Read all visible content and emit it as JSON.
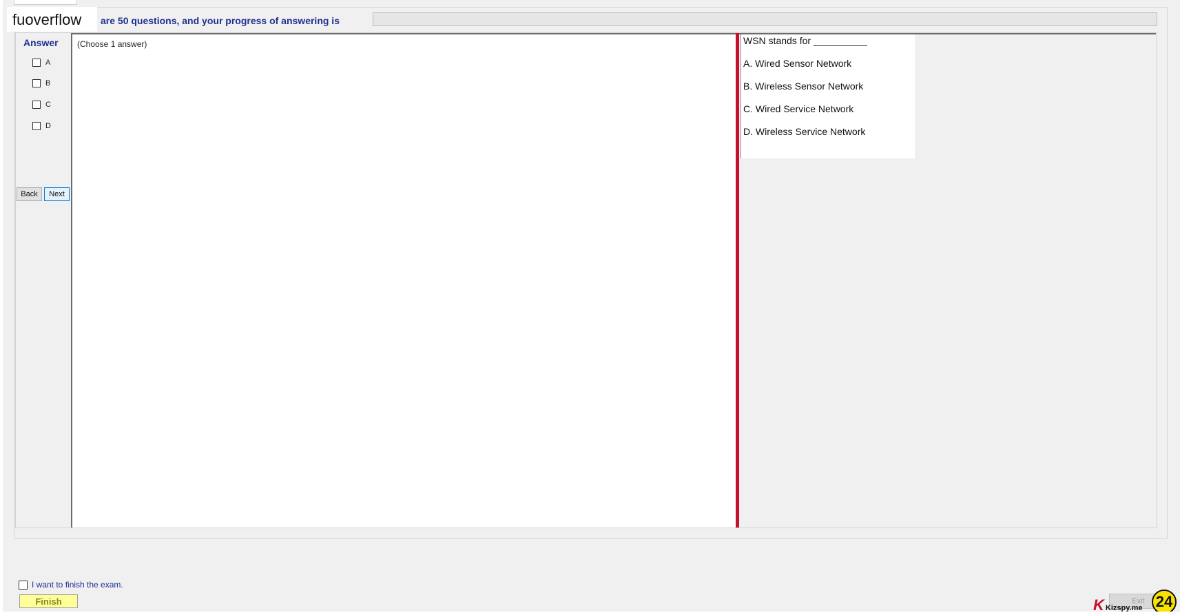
{
  "header": {
    "logo_text": "fuoverflow",
    "progress_text": "are 50 questions, and your progress of answering is",
    "progress_fraction": 0
  },
  "answer_panel": {
    "title": "Answer",
    "options": [
      "A",
      "B",
      "C",
      "D"
    ],
    "back_label": "Back",
    "next_label": "Next"
  },
  "content": {
    "instruction": "(Choose 1 answer)"
  },
  "question": {
    "stem": "WSN stands for __________",
    "choices": [
      "A.  Wired Sensor Network",
      "B.  Wireless Sensor Network",
      "C.  Wired Service Network",
      "D.  Wireless Service Network"
    ]
  },
  "footer": {
    "finish_checkbox_label": "I want to finish the exam.",
    "finish_label": "Finish",
    "exit_label": "Exit",
    "watermark_k": "K",
    "watermark_text": "Kizspy.me",
    "badge_text": "24"
  },
  "colors": {
    "accent_blue": "#1f2f8f",
    "divider_red": "#c8102e",
    "finish_yellow": "#ffff99",
    "badge_yellow": "#f6e400"
  }
}
